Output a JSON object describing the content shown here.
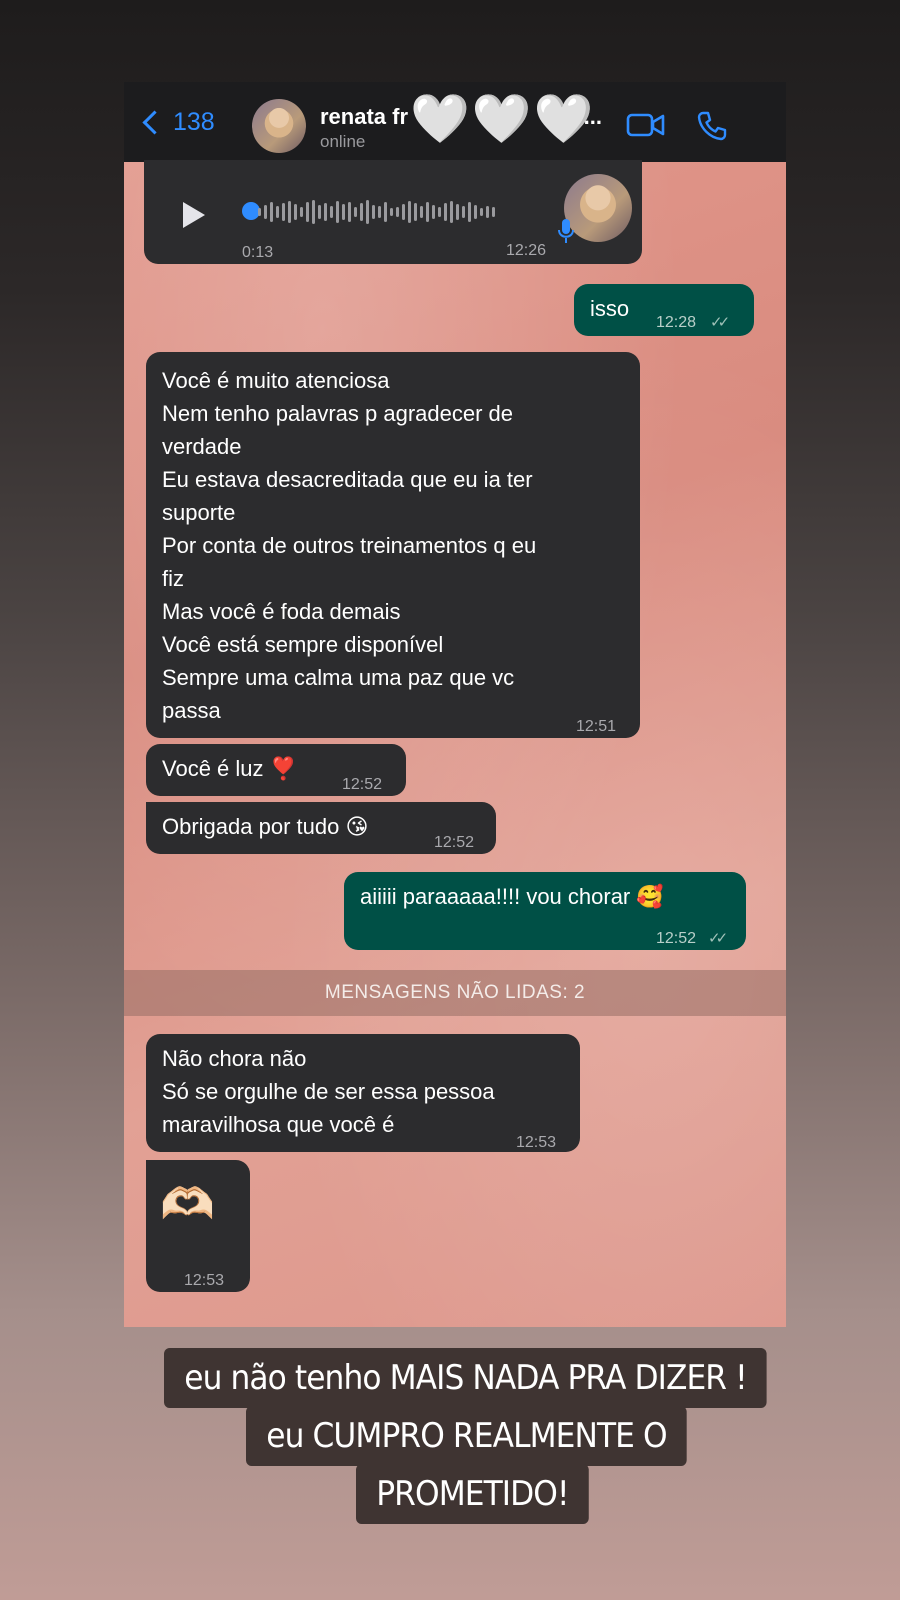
{
  "header": {
    "back_count": "138",
    "contact_name": "renata fr",
    "contact_name_tail": "lu...",
    "status": "online"
  },
  "messages": [
    {
      "kind": "voice",
      "duration": "0:13",
      "time": "12:26"
    },
    {
      "kind": "out",
      "text": "isso",
      "time": "12:28"
    },
    {
      "kind": "in",
      "lines": [
        "Você é muito atenciosa",
        "Nem tenho palavras p agradecer de",
        "verdade",
        "Eu estava desacreditada que eu ia ter",
        "suporte",
        "Por conta de outros treinamentos q eu",
        "fiz",
        "Mas você é foda demais",
        "Você está sempre disponível",
        "Sempre uma calma uma paz que vc",
        "passa"
      ],
      "time": "12:51"
    },
    {
      "kind": "in",
      "text": "Você é luz ❣️",
      "time": "12:52"
    },
    {
      "kind": "in",
      "text": "Obrigada por tudo 😘",
      "time": "12:52"
    },
    {
      "kind": "out",
      "text": "aiiiii paraaaaa!!!! vou chorar 🥰",
      "time": "12:52"
    },
    {
      "kind": "in",
      "lines": [
        "Não chora não",
        "Só se orgulhe de ser essa pessoa",
        "maravilhosa que você é"
      ],
      "time": "12:53"
    },
    {
      "kind": "in",
      "text": "🫶🏻",
      "time": "12:53"
    }
  ],
  "unread_banner": "MENSAGENS NÃO LIDAS: 2",
  "caption": {
    "line1": "eu não tenho MAIS NADA PRA DIZER !",
    "line2": "eu CUMPRO REALMENTE O",
    "line3": "PROMETIDO!"
  },
  "icons": [
    "chevron-left-icon",
    "video-call-icon",
    "phone-icon",
    "play-icon",
    "microphone-icon",
    "double-check-icon"
  ],
  "colors": {
    "accent": "#2f8cff",
    "incoming_bubble": "#2c2c2e",
    "outgoing_bubble": "#005046",
    "chat_background": "#e0978b"
  }
}
